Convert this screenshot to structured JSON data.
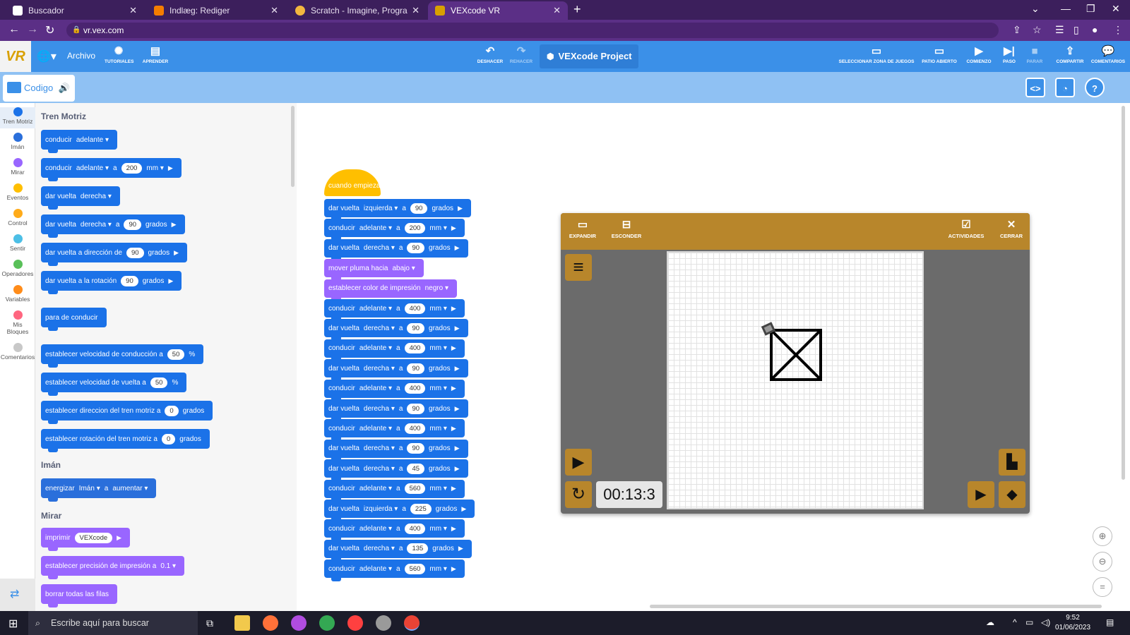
{
  "browser": {
    "tabs": [
      {
        "title": "Buscador",
        "active": false,
        "favicon_color": "#ffffff"
      },
      {
        "title": "Indlæg: Rediger",
        "active": false,
        "favicon_color": "#f57d00"
      },
      {
        "title": "Scratch - Imagine, Program, Shar",
        "active": false,
        "favicon_color": "#f3b73f"
      },
      {
        "title": "VEXcode VR",
        "active": true,
        "favicon_color": "#d9a000"
      }
    ],
    "url": "vr.vex.com"
  },
  "app": {
    "logo": "VR",
    "archivo_label": "Archivo",
    "tutoriales_label": "TUTORIALES",
    "aprender_label": "APRENDER",
    "deshacer_label": "DESHACER",
    "rehacer_label": "REHACER",
    "project_name": "VEXcode Project",
    "seleccionar_label": "SELECCIONAR ZONA DE JUEGOS",
    "patio_label": "PATIO ABIERTO",
    "comienzo_label": "COMIENZO",
    "paso_label": "PASO",
    "parar_label": "PARAR",
    "compartir_label": "COMPARTIR",
    "comentarios_label": "COMENTARIOS",
    "code_tab_label": "Codigo",
    "accent": "#3b90e8"
  },
  "categories": [
    {
      "label": "Tren Motriz",
      "color": "#1b72e8"
    },
    {
      "label": "Imán",
      "color": "#2a6fdb"
    },
    {
      "label": "Mirar",
      "color": "#9966ff"
    },
    {
      "label": "Eventos",
      "color": "#ffbf00"
    },
    {
      "label": "Control",
      "color": "#ffab19"
    },
    {
      "label": "Sentir",
      "color": "#4cbfe6"
    },
    {
      "label": "Operadores",
      "color": "#59c059"
    },
    {
      "label": "Variables",
      "color": "#ff8c1a"
    },
    {
      "label": "Mis Bloques",
      "color": "#ff6680"
    },
    {
      "label": "Comentarios",
      "color": "#c8c8c8"
    }
  ],
  "palette": {
    "tren_motriz_heading": "Tren Motriz",
    "iman_heading": "Imán",
    "mirar_heading": "Mirar",
    "b1": {
      "cmd": "conducir",
      "dir": "adelante"
    },
    "b2": {
      "cmd": "conducir",
      "dir": "adelante",
      "a": "a",
      "val": "200",
      "unit": "mm"
    },
    "b3": {
      "cmd": "dar vuelta",
      "dir": "derecha"
    },
    "b4": {
      "cmd": "dar vuelta",
      "dir": "derecha",
      "a": "a",
      "val": "90",
      "unit": "grados"
    },
    "b5": {
      "cmd": "dar vuelta a dirección de",
      "val": "90",
      "unit": "grados"
    },
    "b6": {
      "cmd": "dar vuelta a la rotación",
      "val": "90",
      "unit": "grados"
    },
    "b7": {
      "cmd": "para de conducir"
    },
    "b8": {
      "cmd": "establecer velocidad de conducción a",
      "val": "50",
      "unit": "%"
    },
    "b9": {
      "cmd": "establecer velocidad de vuelta a",
      "val": "50",
      "unit": "%"
    },
    "b10": {
      "cmd": "establecer direccion del tren motriz a",
      "val": "0",
      "unit": "grados"
    },
    "b11": {
      "cmd": "establecer rotación del tren motriz a",
      "val": "0",
      "unit": "grados"
    },
    "b12": {
      "cmd": "energizar",
      "dev": "Imán",
      "a": "a",
      "act": "aumentar"
    },
    "b13": {
      "cmd": "imprimir",
      "val": "VEXcode"
    },
    "b14": {
      "cmd": "establecer precisión de impresión a",
      "val": "0.1"
    },
    "b15": {
      "cmd": "borrar todas las filas"
    }
  },
  "script": {
    "hat": "cuando empieza",
    "blocks": [
      {
        "cmd": "dar vuelta",
        "dir": "izquierda",
        "a": "a",
        "val": "90",
        "unit": "grados",
        "kind": "turn"
      },
      {
        "cmd": "conducir",
        "dir": "adelante",
        "a": "a",
        "val": "200",
        "unit": "mm",
        "kind": "drive"
      },
      {
        "cmd": "dar vuelta",
        "dir": "derecha",
        "a": "a",
        "val": "90",
        "unit": "grados",
        "kind": "turn"
      },
      {
        "cmd": "mover pluma hacia",
        "dir": "abajo",
        "kind": "pen"
      },
      {
        "cmd": "establecer color de impresión",
        "dir": "negro",
        "kind": "pen"
      },
      {
        "cmd": "conducir",
        "dir": "adelante",
        "a": "a",
        "val": "400",
        "unit": "mm",
        "kind": "drive"
      },
      {
        "cmd": "dar vuelta",
        "dir": "derecha",
        "a": "a",
        "val": "90",
        "unit": "grados",
        "kind": "turn"
      },
      {
        "cmd": "conducir",
        "dir": "adelante",
        "a": "a",
        "val": "400",
        "unit": "mm",
        "kind": "drive"
      },
      {
        "cmd": "dar vuelta",
        "dir": "derecha",
        "a": "a",
        "val": "90",
        "unit": "grados",
        "kind": "turn"
      },
      {
        "cmd": "conducir",
        "dir": "adelante",
        "a": "a",
        "val": "400",
        "unit": "mm",
        "kind": "drive"
      },
      {
        "cmd": "dar vuelta",
        "dir": "derecha",
        "a": "a",
        "val": "90",
        "unit": "grados",
        "kind": "turn"
      },
      {
        "cmd": "conducir",
        "dir": "adelante",
        "a": "a",
        "val": "400",
        "unit": "mm",
        "kind": "drive"
      },
      {
        "cmd": "dar vuelta",
        "dir": "derecha",
        "a": "a",
        "val": "90",
        "unit": "grados",
        "kind": "turn"
      },
      {
        "cmd": "dar vuelta",
        "dir": "derecha",
        "a": "a",
        "val": "45",
        "unit": "grados",
        "kind": "turn"
      },
      {
        "cmd": "conducir",
        "dir": "adelante",
        "a": "a",
        "val": "560",
        "unit": "mm",
        "kind": "drive"
      },
      {
        "cmd": "dar vuelta",
        "dir": "izquierda",
        "a": "a",
        "val": "225",
        "unit": "grados",
        "kind": "turn"
      },
      {
        "cmd": "conducir",
        "dir": "adelante",
        "a": "a",
        "val": "400",
        "unit": "mm",
        "kind": "drive"
      },
      {
        "cmd": "dar vuelta",
        "dir": "derecha",
        "a": "a",
        "val": "135",
        "unit": "grados",
        "kind": "turn"
      },
      {
        "cmd": "conducir",
        "dir": "adelante",
        "a": "a",
        "val": "560",
        "unit": "mm",
        "kind": "drive"
      }
    ]
  },
  "vr": {
    "expandir_label": "EXPANDIR",
    "esconder_label": "ESCONDER",
    "actividades_label": "ACTIVIDADES",
    "cerrar_label": "CERRAR",
    "timer": "00:13:3",
    "header_color": "#b8862b"
  },
  "taskbar": {
    "search_placeholder": "Escribe aquí para buscar",
    "time": "9:52",
    "date": "01/06/2023"
  }
}
